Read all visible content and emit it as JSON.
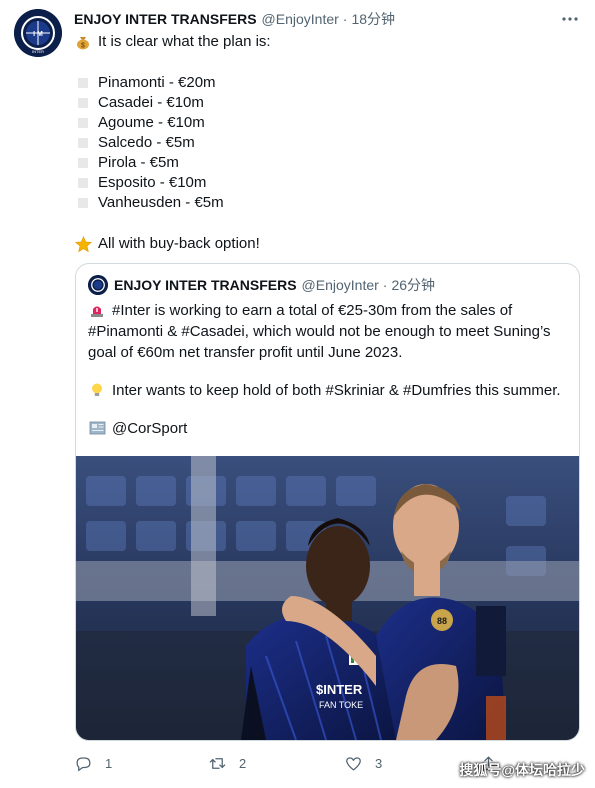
{
  "tweet": {
    "author_name": "ENJOY INTER TRANSFERS",
    "author_handle": "@EnjoyInter",
    "separator": "·",
    "time": "18分钟",
    "avatar_icon": "inter-logo-icon",
    "intro": "It is clear what the plan is:",
    "intro_icon": "money-bag-icon",
    "list": [
      "Pinamonti - €20m",
      "Casadei - €10m",
      "Agoume - €10m",
      "Salcedo - €5m",
      "Pirola - €5m",
      "Esposito - €10m",
      "Vanheusden - €5m"
    ],
    "outro": "All with buy-back option!",
    "outro_icon": "star-icon"
  },
  "quote": {
    "author_name": "ENJOY INTER TRANSFERS",
    "author_handle": "@EnjoyInter",
    "separator": "·",
    "time": "26分钟",
    "paragraph1": "#Inter is working to earn a total of €25-30m from the sales of #Pinamonti & #Casadei, which would not be enough to meet Suning’s goal of €60m net transfer profit until June 2023.",
    "paragraph1_icon": "siren-icon",
    "paragraph2": "Inter wants to keep hold of both #Skriniar & #Dumfries this summer.",
    "paragraph2_icon": "lightbulb-icon",
    "source": "@CorSport",
    "source_icon": "newspaper-icon"
  },
  "actions": {
    "reply_count": "1",
    "retweet_count": "2",
    "like_count": "3"
  },
  "watermark": "搜狐号@体坛哈拉少",
  "colors": {
    "text": "#0f1419",
    "secondary": "#536471",
    "border": "#cfd9de",
    "inter_blue": "#0c1f4a"
  }
}
